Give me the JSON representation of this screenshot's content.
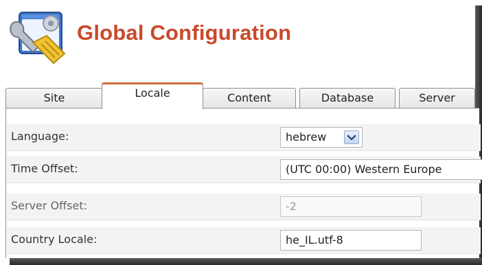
{
  "header": {
    "title": "Global Configuration",
    "logo_icon": "wrench-config-icon"
  },
  "tabs": [
    {
      "label": "Site",
      "active": false
    },
    {
      "label": "Locale",
      "active": true
    },
    {
      "label": "Content",
      "active": false
    },
    {
      "label": "Database",
      "active": false
    },
    {
      "label": "Server",
      "active": false
    }
  ],
  "form": {
    "language": {
      "label": "Language:",
      "value": "hebrew"
    },
    "time_offset": {
      "label": "Time Offset:",
      "value": "(UTC 00:00) Western Europe"
    },
    "server_offset": {
      "label": "Server Offset:",
      "value": "-2"
    },
    "country_locale": {
      "label": "Country Locale:",
      "value": "he_IL.utf-8"
    }
  },
  "colors": {
    "title": "#c94a2a",
    "active_tab_accent": "#cf6a3c"
  }
}
